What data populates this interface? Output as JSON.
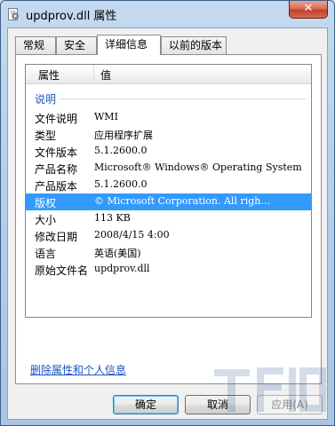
{
  "window": {
    "title": "updprov.dll 属性",
    "close_glyph": "✕"
  },
  "tabs": [
    {
      "label": "常规",
      "active": false
    },
    {
      "label": "安全",
      "active": false
    },
    {
      "label": "详细信息",
      "active": true
    },
    {
      "label": "以前的版本",
      "active": false
    }
  ],
  "details": {
    "columns": {
      "property": "属性",
      "value": "值"
    },
    "group": "说明",
    "rows": [
      {
        "property": "文件说明",
        "value": "WMI"
      },
      {
        "property": "类型",
        "value": "应用程序扩展"
      },
      {
        "property": "文件版本",
        "value": "5.1.2600.0"
      },
      {
        "property": "产品名称",
        "value": "Microsoft® Windows® Operating System"
      },
      {
        "property": "产品版本",
        "value": "5.1.2600.0"
      },
      {
        "property": "版权",
        "value": "© Microsoft Corporation. All righ...",
        "selected": true
      },
      {
        "property": "大小",
        "value": "113 KB"
      },
      {
        "property": "修改日期",
        "value": "2008/4/15 4:00"
      },
      {
        "property": "语言",
        "value": "英语(美国)"
      },
      {
        "property": "原始文件名",
        "value": "updprov.dll"
      }
    ]
  },
  "remove_link": "删除属性和个人信息",
  "buttons": {
    "ok": "确定",
    "cancel": "取消",
    "apply": "应用(A)"
  },
  "colors": {
    "selection": "#3399ff",
    "link": "#1d55c7",
    "group_heading": "#1e5bbf"
  }
}
